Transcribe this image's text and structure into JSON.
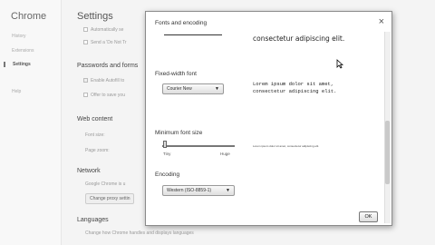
{
  "app": {
    "title": "Chrome"
  },
  "sidebar": {
    "items": [
      {
        "label": "History"
      },
      {
        "label": "Extensions"
      },
      {
        "label": "Settings"
      },
      {
        "label": "Help"
      }
    ]
  },
  "main": {
    "title": "Settings",
    "options": [
      {
        "label": "Automatically se"
      },
      {
        "label": "Send a 'Do Not Tr"
      }
    ],
    "passwords_heading": "Passwords and forms",
    "password_options": [
      {
        "label": "Enable Autofill to"
      },
      {
        "label": "Offer to save you"
      }
    ],
    "web_content_heading": "Web content",
    "font_size_label": "Font size:",
    "page_zoom_label": "Page zoom:",
    "network_heading": "Network",
    "network_text": "Google Chrome is u",
    "proxy_button": "Change proxy settin",
    "languages_heading": "Languages",
    "languages_text": "Change how Chrome handles and displays languages"
  },
  "dialog": {
    "title": "Fonts and encoding",
    "close_icon": "close-icon",
    "sample_top": "consectetur adipiscing elit.",
    "fixed_width_heading": "Fixed-width font",
    "fixed_width_value": "Courier New",
    "fixed_width_sample": "Lorem ipsum dolor sit amet,\nconsectetur adipiscing elit.",
    "min_font_heading": "Minimum font size",
    "slider_min_label": "Tiny",
    "slider_max_label": "Huge",
    "slider_level": 0.0,
    "min_font_sample": "Lorem ipsum dolor sit amet, consectetur adipiscing elit.",
    "encoding_heading": "Encoding",
    "encoding_value": "Western (ISO-8859-1)",
    "ok_label": "OK"
  }
}
